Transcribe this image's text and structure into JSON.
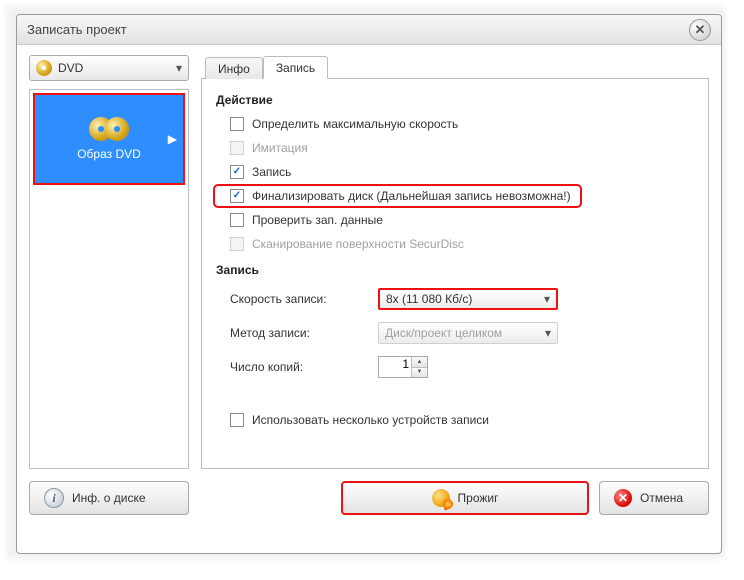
{
  "window": {
    "title": "Записать проект"
  },
  "drive": {
    "label": "DVD"
  },
  "sidebar": {
    "thumb_label": "Образ DVD"
  },
  "tabs": {
    "info": "Инфо",
    "record": "Запись"
  },
  "sections": {
    "action": "Действие",
    "record": "Запись"
  },
  "checks": {
    "max_speed": {
      "label": "Определить максимальную скорость",
      "checked": false,
      "disabled": false
    },
    "simulation": {
      "label": "Имитация",
      "checked": false,
      "disabled": true
    },
    "write": {
      "label": "Запись",
      "checked": true,
      "disabled": false
    },
    "finalize": {
      "label": "Финализировать диск (Дальнейшая запись невозможна!)",
      "checked": true,
      "disabled": false
    },
    "verify": {
      "label": "Проверить зап. данные",
      "checked": false,
      "disabled": false
    },
    "securdisc": {
      "label": "Сканирование поверхности SecurDisc",
      "checked": false,
      "disabled": true
    },
    "multi_device": {
      "label": "Использовать несколько устройств записи",
      "checked": false,
      "disabled": false
    }
  },
  "form": {
    "speed_label": "Скорость записи:",
    "speed_value": "8x (11 080 Кб/с)",
    "method_label": "Метод записи:",
    "method_value": "Диск/проект целиком",
    "copies_label": "Число копий:",
    "copies_value": "1"
  },
  "footer": {
    "disc_info": "Инф. о диске",
    "burn": "Прожиг",
    "cancel": "Отмена"
  }
}
